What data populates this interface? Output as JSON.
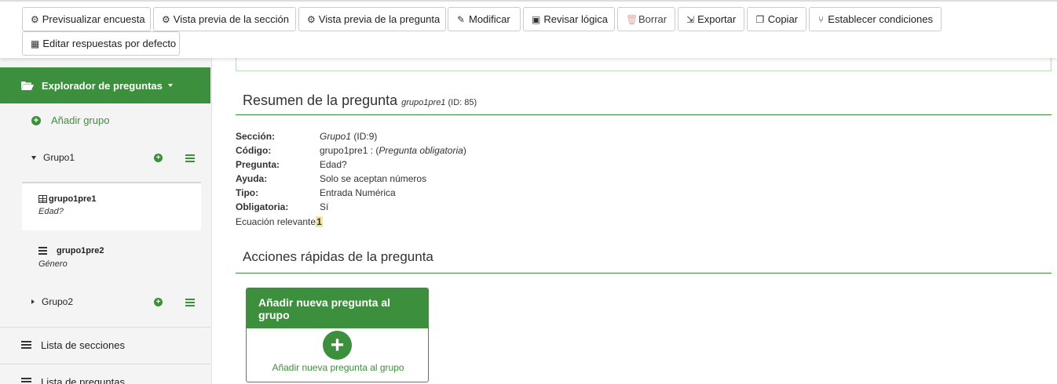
{
  "toolbar": {
    "buttons": [
      {
        "label": "Previsualizar encuesta",
        "icon": "gear-icon"
      },
      {
        "label": "Vista previa de la sección",
        "icon": "gear-icon"
      },
      {
        "label": "Vista previa de la pregunta",
        "icon": "gear-icon"
      },
      {
        "label": "Modificar",
        "icon": "pencil-icon"
      },
      {
        "label": "Revisar lógica",
        "icon": "logic-icon"
      },
      {
        "label": "Borrar",
        "icon": "trash-icon"
      },
      {
        "label": "Exportar",
        "icon": "export-icon"
      },
      {
        "label": "Copiar",
        "icon": "copy-icon"
      },
      {
        "label": "Establecer condiciones",
        "icon": "conditions-icon"
      },
      {
        "label": "Editar respuestas por defecto",
        "icon": "table-icon"
      }
    ]
  },
  "sidebar": {
    "explorer_label": "Explorador de preguntas",
    "add_group_label": "Añadir grupo",
    "groups": [
      {
        "name": "Grupo1"
      },
      {
        "name": "Grupo2"
      }
    ],
    "questions": [
      {
        "code": "grupo1pre1",
        "text": "Edad?"
      },
      {
        "code": "grupo1pre2",
        "text": "Género"
      }
    ],
    "links": [
      {
        "label": "Lista de secciones"
      },
      {
        "label": "Lista de preguntas"
      }
    ]
  },
  "summary": {
    "title": "Resumen de la pregunta",
    "code_italic": "grupo1pre1",
    "id_text": "(ID: 85)",
    "rows": {
      "seccion": {
        "label": "Sección:",
        "value_italic": "Grupo1",
        "value_rest": " (ID:9)"
      },
      "codigo": {
        "label": "Código:",
        "value": "grupo1pre1 : (",
        "value_italic": "Pregunta obligatoria",
        "value_close": ")"
      },
      "pregunta": {
        "label": "Pregunta:",
        "value": "Edad?"
      },
      "ayuda": {
        "label": "Ayuda:",
        "value": "Solo se aceptan números"
      },
      "tipo": {
        "label": "Tipo:",
        "value": "Entrada Numérica"
      },
      "obligatoria": {
        "label": "Obligatoria:",
        "value": "Sí"
      },
      "ecuacion": {
        "label": "Ecuación relevante",
        "value": "1"
      }
    }
  },
  "quick_actions": {
    "title": "Acciones rápidas de la pregunta",
    "card_title": "Añadir nueva pregunta al grupo",
    "card_link": "Añadir nueva pregunta al grupo"
  },
  "colors": {
    "accent": "#3c8f3c"
  }
}
